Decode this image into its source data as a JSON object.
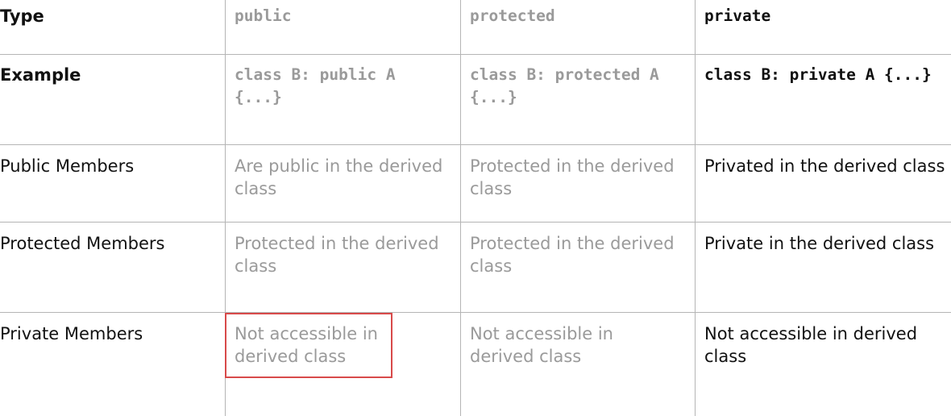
{
  "table": {
    "header": {
      "type": "Type",
      "public": "public",
      "protected": "protected",
      "private": "private"
    },
    "example": {
      "label": "Example",
      "public": "class B: public A {...}",
      "protected": "class B: protected A {...}",
      "private": "class B: private A {...}"
    },
    "public_members": {
      "label": "Public Members",
      "public": "Are public in the derived class",
      "protected": "Protected in the derived class",
      "private": "Privated in the derived class"
    },
    "protected_members": {
      "label": "Protected Members",
      "public": "Protected in the derived class",
      "protected": "Protected in the derived class",
      "private": "Private in the derived class"
    },
    "private_members": {
      "label": "Private Members",
      "public": "Not accessible in derived class",
      "protected": "Not accessible in derived class",
      "private": "Not accessible in derived class"
    }
  },
  "colors": {
    "muted_text": "#9a9a9a",
    "strong_text": "#111111",
    "grid_line": "#b5b5b5",
    "highlight_border": "#d84a4a"
  }
}
